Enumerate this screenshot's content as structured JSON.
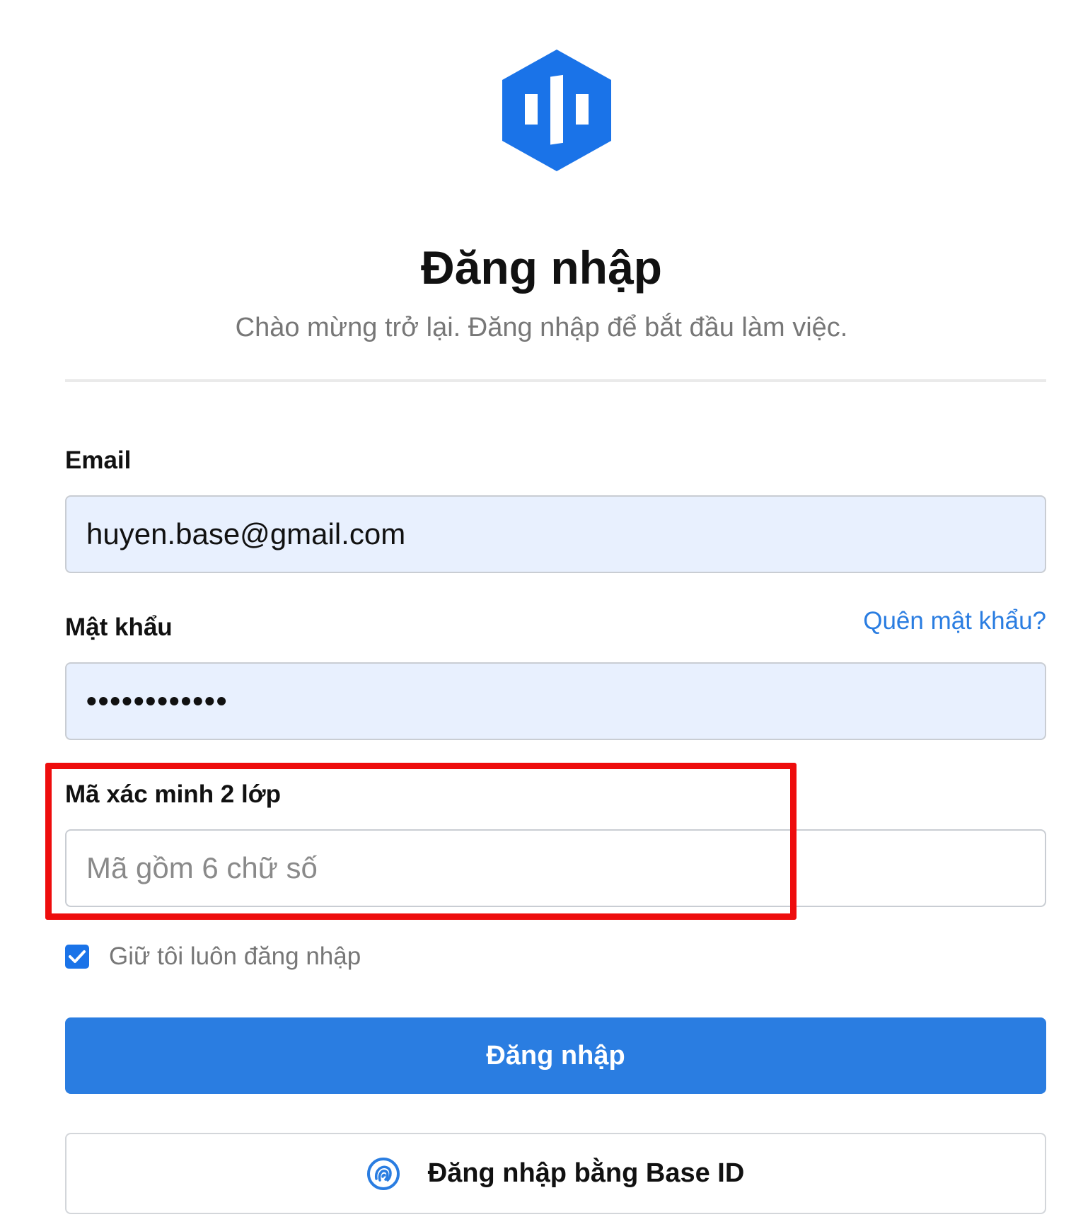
{
  "header": {
    "logo_icon": "base-hexagon-logo",
    "brand_color": "#1a73e8",
    "title": "Đăng nhập",
    "subtitle": "Chào mừng trở lại. Đăng nhập để bắt đầu làm việc."
  },
  "form": {
    "email": {
      "label": "Email",
      "value": "huyen.base@gmail.com"
    },
    "password": {
      "label": "Mật khẩu",
      "value": "••••••••••••",
      "forgot_link": "Quên mật khẩu?"
    },
    "two_factor": {
      "label": "Mã xác minh 2 lớp",
      "placeholder": "Mã gồm 6 chữ số",
      "value": "",
      "highlighted": true,
      "highlight_color": "#ee0d0d"
    },
    "remember_me": {
      "label": "Giữ tôi luôn đăng nhập",
      "checked": true
    },
    "submit_label": "Đăng nhập",
    "base_id_button": {
      "label": "Đăng nhập bằng Base ID",
      "icon": "fingerprint-icon"
    }
  },
  "colors": {
    "accent": "#2a7de1",
    "input_fill": "#e8f0fe",
    "muted_text": "#777777"
  }
}
